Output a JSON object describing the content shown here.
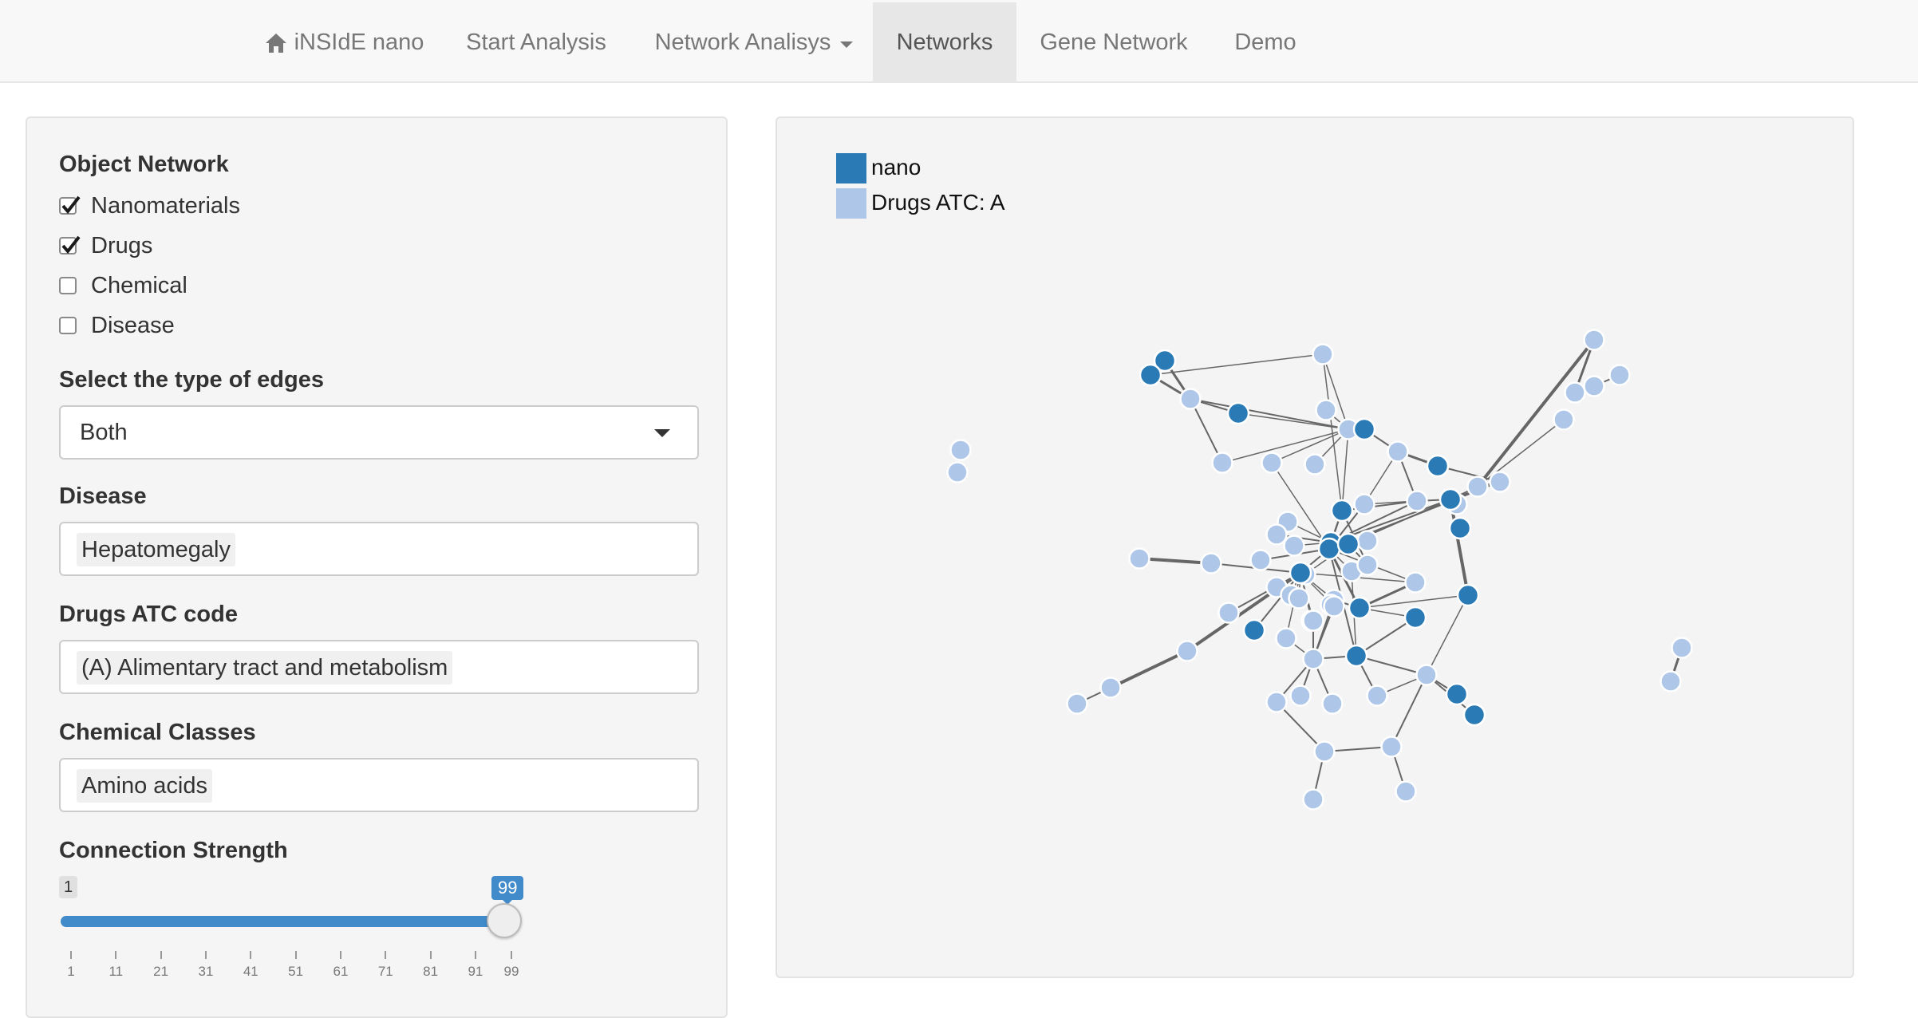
{
  "navbar": {
    "brand": "iNSIdE nano",
    "items": [
      {
        "label": "Start Analysis"
      },
      {
        "label": "Network Analisys"
      },
      {
        "label": "Networks"
      },
      {
        "label": "Gene Network"
      },
      {
        "label": "Demo"
      }
    ],
    "active": "Networks",
    "brand_icon": "home-icon",
    "dropdown_icon": "caret-down-icon"
  },
  "sidebar": {
    "object_network": {
      "title": "Object Network",
      "options": [
        {
          "label": "Nanomaterials",
          "checked": true
        },
        {
          "label": "Drugs",
          "checked": true
        },
        {
          "label": "Chemical",
          "checked": false
        },
        {
          "label": "Disease",
          "checked": false
        }
      ]
    },
    "edge_type": {
      "title": "Select the type of edges",
      "value": "Both"
    },
    "disease": {
      "title": "Disease",
      "selected": "Hepatomegaly"
    },
    "drugs_atc": {
      "title": "Drugs ATC code",
      "selected": "(A) Alimentary tract and metabolism"
    },
    "chemical_classes": {
      "title": "Chemical Classes",
      "selected": "Amino acids"
    },
    "connection_strength": {
      "title": "Connection Strength",
      "min": 1,
      "max": 99,
      "value_from": "1",
      "value_to": "99",
      "ticks": [
        "1",
        "11",
        "21",
        "31",
        "41",
        "51",
        "61",
        "71",
        "81",
        "91",
        "99"
      ]
    }
  },
  "network": {
    "legend": [
      {
        "label": "nano",
        "color": "#2a7ab5"
      },
      {
        "label": "Drugs ATC: A",
        "color": "#aec7e8"
      }
    ]
  },
  "colors": {
    "accent": "#428bca",
    "nano_node": "#2a7ab5",
    "drug_node": "#aec7e8",
    "edge": "#666666"
  }
}
